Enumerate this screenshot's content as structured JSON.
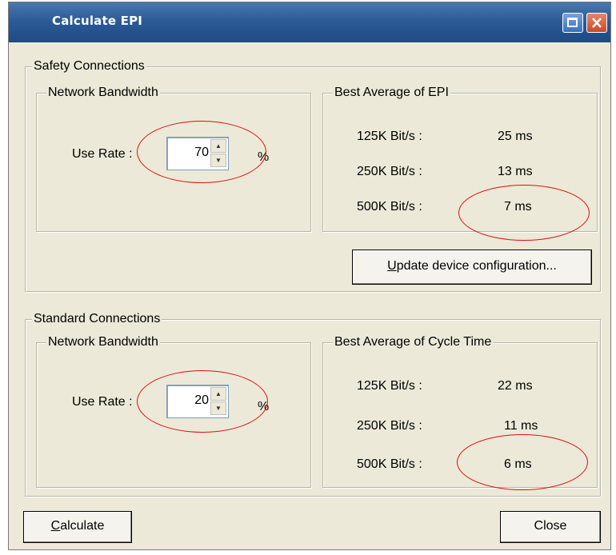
{
  "window": {
    "title": "Calculate EPI"
  },
  "safety": {
    "group_label": "Safety Connections",
    "bandwidth_label": "Network Bandwidth",
    "use_rate_label": "Use Rate :",
    "use_rate_value": "70",
    "percent": "%",
    "best_label": "Best Average of EPI",
    "rows": [
      {
        "rate": "125K Bit/s :",
        "value": "25 ms"
      },
      {
        "rate": "250K Bit/s :",
        "value": "13 ms"
      },
      {
        "rate": "500K Bit/s :",
        "value": "7 ms"
      }
    ],
    "update_button": {
      "mnemonic": "U",
      "rest": "pdate device configuration..."
    }
  },
  "standard": {
    "group_label": "Standard Connections",
    "bandwidth_label": "Network Bandwidth",
    "use_rate_label": "Use Rate :",
    "use_rate_value": "20",
    "percent": "%",
    "best_label": "Best Average of Cycle Time",
    "rows": [
      {
        "rate": "125K Bit/s :",
        "value": "22 ms"
      },
      {
        "rate": "250K Bit/s :",
        "value": "11 ms"
      },
      {
        "rate": "500K Bit/s :",
        "value": "6 ms"
      }
    ]
  },
  "footer": {
    "calculate": {
      "mnemonic": "C",
      "rest": "alculate"
    },
    "close": "Close"
  },
  "colors": {
    "title_bar": "#2c5b96",
    "dialog_bg": "#ece9d8",
    "annotation": "#d91010"
  },
  "icons": [
    "restore-icon",
    "close-icon",
    "spin-up-icon",
    "spin-down-icon"
  ]
}
